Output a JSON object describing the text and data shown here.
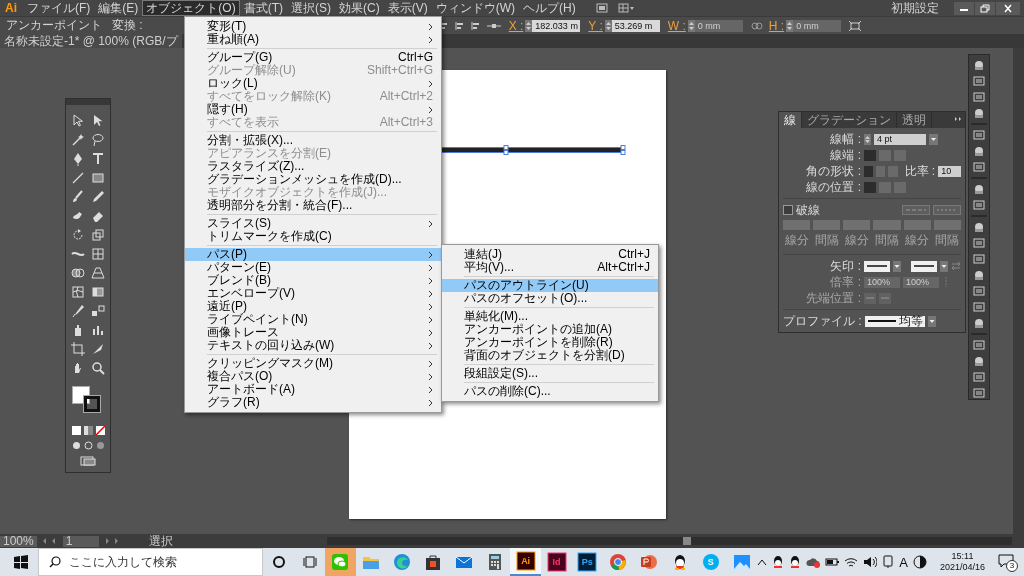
{
  "menu_bar": {
    "logo": "Ai",
    "items": [
      {
        "label": "ファイル(F)",
        "selected": false
      },
      {
        "label": "編集(E)",
        "selected": false
      },
      {
        "label": "オブジェクト(O)",
        "selected": true
      },
      {
        "label": "書式(T)",
        "selected": false
      },
      {
        "label": "選択(S)",
        "selected": false
      },
      {
        "label": "効果(C)",
        "selected": false
      },
      {
        "label": "表示(V)",
        "selected": false
      },
      {
        "label": "ウィンドウ(W)",
        "selected": false
      },
      {
        "label": "ヘルプ(H)",
        "selected": false
      }
    ],
    "workspace": "初期設定"
  },
  "control_bar": {
    "mode": "アンカーポイント",
    "convert_label": "変換 :",
    "fields": [
      {
        "label": "X :",
        "value": "182.033 m",
        "disabled": false
      },
      {
        "label": "Y :",
        "value": "53.269 m",
        "disabled": false
      },
      {
        "label": "W :",
        "value": "0 mm",
        "disabled": true
      },
      {
        "label": "H :",
        "value": "0 mm",
        "disabled": true
      }
    ]
  },
  "document_tab": "名称未設定-1* @ 100% (RGB/プ",
  "object_menu": {
    "items": [
      {
        "kind": "item",
        "label": "変形(T)",
        "submenu": true,
        "disabled": false,
        "selected": false
      },
      {
        "kind": "item",
        "label": "重ね順(A)",
        "submenu": true,
        "disabled": false,
        "selected": false
      },
      {
        "kind": "separator"
      },
      {
        "kind": "item",
        "label": "グループ(G)",
        "shortcut": "Ctrl+G",
        "submenu": false,
        "disabled": false,
        "selected": false
      },
      {
        "kind": "item",
        "label": "グループ解除(U)",
        "shortcut": "Shift+Ctrl+G",
        "submenu": false,
        "disabled": true,
        "selected": false
      },
      {
        "kind": "item",
        "label": "ロック(L)",
        "submenu": true,
        "disabled": false,
        "selected": false
      },
      {
        "kind": "item",
        "label": "すべてをロック解除(K)",
        "shortcut": "Alt+Ctrl+2",
        "submenu": false,
        "disabled": true,
        "selected": false
      },
      {
        "kind": "item",
        "label": "隠す(H)",
        "submenu": true,
        "disabled": false,
        "selected": false
      },
      {
        "kind": "item",
        "label": "すべてを表示",
        "shortcut": "Alt+Ctrl+3",
        "submenu": false,
        "disabled": true,
        "selected": false
      },
      {
        "kind": "separator"
      },
      {
        "kind": "item",
        "label": "分割・拡張(X)...",
        "submenu": false,
        "disabled": false,
        "selected": false
      },
      {
        "kind": "item",
        "label": "アピアランスを分割(E)",
        "submenu": false,
        "disabled": true,
        "selected": false
      },
      {
        "kind": "item",
        "label": "ラスタライズ(Z)...",
        "submenu": false,
        "disabled": false,
        "selected": false
      },
      {
        "kind": "item",
        "label": "グラデーションメッシュを作成(D)...",
        "submenu": false,
        "disabled": false,
        "selected": false
      },
      {
        "kind": "item",
        "label": "モザイクオブジェクトを作成(J)...",
        "submenu": false,
        "disabled": true,
        "selected": false
      },
      {
        "kind": "item",
        "label": "透明部分を分割・統合(F)...",
        "submenu": false,
        "disabled": false,
        "selected": false
      },
      {
        "kind": "separator"
      },
      {
        "kind": "item",
        "label": "スライス(S)",
        "submenu": true,
        "disabled": false,
        "selected": false
      },
      {
        "kind": "item",
        "label": "トリムマークを作成(C)",
        "submenu": false,
        "disabled": false,
        "selected": false
      },
      {
        "kind": "separator"
      },
      {
        "kind": "item",
        "label": "パス(P)",
        "submenu": true,
        "disabled": false,
        "selected": true
      },
      {
        "kind": "item",
        "label": "パターン(E)",
        "submenu": true,
        "disabled": false,
        "selected": false
      },
      {
        "kind": "item",
        "label": "ブレンド(B)",
        "submenu": true,
        "disabled": false,
        "selected": false
      },
      {
        "kind": "item",
        "label": "エンベロープ(V)",
        "submenu": true,
        "disabled": false,
        "selected": false
      },
      {
        "kind": "item",
        "label": "遠近(P)",
        "submenu": true,
        "disabled": false,
        "selected": false
      },
      {
        "kind": "item",
        "label": "ライブペイント(N)",
        "submenu": true,
        "disabled": false,
        "selected": false
      },
      {
        "kind": "item",
        "label": "画像トレース",
        "submenu": true,
        "disabled": false,
        "selected": false
      },
      {
        "kind": "item",
        "label": "テキストの回り込み(W)",
        "submenu": true,
        "disabled": false,
        "selected": false
      },
      {
        "kind": "separator"
      },
      {
        "kind": "item",
        "label": "クリッピングマスク(M)",
        "submenu": true,
        "disabled": false,
        "selected": false
      },
      {
        "kind": "item",
        "label": "複合パス(O)",
        "submenu": true,
        "disabled": false,
        "selected": false
      },
      {
        "kind": "item",
        "label": "アートボード(A)",
        "submenu": true,
        "disabled": false,
        "selected": false
      },
      {
        "kind": "item",
        "label": "グラフ(R)",
        "submenu": true,
        "disabled": false,
        "selected": false
      }
    ]
  },
  "path_submenu": {
    "items": [
      {
        "kind": "item",
        "label": "連結(J)",
        "shortcut": "Ctrl+J",
        "submenu": false,
        "disabled": false,
        "selected": false
      },
      {
        "kind": "item",
        "label": "平均(V)...",
        "shortcut": "Alt+Ctrl+J",
        "submenu": false,
        "disabled": false,
        "selected": false
      },
      {
        "kind": "separator"
      },
      {
        "kind": "item",
        "label": "パスのアウトライン(U)",
        "submenu": false,
        "disabled": false,
        "selected": true
      },
      {
        "kind": "item",
        "label": "パスのオフセット(O)...",
        "submenu": false,
        "disabled": false,
        "selected": false
      },
      {
        "kind": "separator"
      },
      {
        "kind": "item",
        "label": "単純化(M)...",
        "submenu": false,
        "disabled": false,
        "selected": false
      },
      {
        "kind": "item",
        "label": "アンカーポイントの追加(A)",
        "submenu": false,
        "disabled": false,
        "selected": false
      },
      {
        "kind": "item",
        "label": "アンカーポイントを削除(R)",
        "submenu": false,
        "disabled": false,
        "selected": false
      },
      {
        "kind": "item",
        "label": "背面のオブジェクトを分割(D)",
        "submenu": false,
        "disabled": false,
        "selected": false
      },
      {
        "kind": "separator"
      },
      {
        "kind": "item",
        "label": "段組設定(S)...",
        "submenu": false,
        "disabled": false,
        "selected": false
      },
      {
        "kind": "separator"
      },
      {
        "kind": "item",
        "label": "パスの削除(C)...",
        "submenu": false,
        "disabled": false,
        "selected": false
      }
    ]
  },
  "stroke_panel": {
    "tabs": [
      {
        "label": "線",
        "selected": true
      },
      {
        "label": "グラデーション",
        "selected": false
      },
      {
        "label": "透明",
        "selected": false
      }
    ],
    "weight": {
      "label": "線幅 :",
      "value": "4 pt"
    },
    "cap": {
      "label": "線端 :",
      "options": [
        {
          "selected": true
        },
        {
          "selected": false
        },
        {
          "selected": false
        }
      ]
    },
    "corner": {
      "label": "角の形状 :",
      "options": [
        {
          "selected": true
        },
        {
          "selected": false
        },
        {
          "selected": false
        }
      ],
      "limit_label": "比率 :",
      "limit": "10"
    },
    "align": {
      "label": "線の位置 :",
      "options": [
        {
          "selected": true
        },
        {
          "selected": false
        },
        {
          "selected": false
        }
      ]
    },
    "dashed": {
      "label": "破線",
      "checked": false
    },
    "dash_fields": [
      "線分",
      "間隔",
      "線分",
      "間隔",
      "線分",
      "間隔"
    ],
    "arrow": {
      "label": "矢印 :"
    },
    "scale": {
      "label": "倍率 :",
      "values": [
        "100%",
        "100%"
      ],
      "disabled": true
    },
    "tip": {
      "label": "先端位置 :",
      "disabled": true
    },
    "profile": {
      "label": "プロファイル :",
      "value": "均等"
    }
  },
  "status_bar": {
    "zoom": "100%",
    "artboard": "1",
    "tool": "選択"
  },
  "taskbar": {
    "search_placeholder": "ここに入力して検索",
    "apps": [
      {
        "kind": "wechat",
        "active": false,
        "attention": true
      },
      {
        "kind": "explorer",
        "active": false,
        "attention": false
      },
      {
        "kind": "edge",
        "active": false,
        "attention": false
      },
      {
        "kind": "store",
        "active": false,
        "attention": false
      },
      {
        "kind": "mail",
        "active": false,
        "attention": false
      },
      {
        "kind": "calculator",
        "active": false,
        "attention": false
      },
      {
        "kind": "illustrator",
        "label": "Ai",
        "active": true,
        "attention": false
      },
      {
        "kind": "indesign",
        "label": "Id",
        "active": false,
        "attention": false
      },
      {
        "kind": "photoshop",
        "label": "Ps",
        "active": false,
        "attention": false
      },
      {
        "kind": "chrome",
        "active": false,
        "attention": false
      },
      {
        "kind": "powerpoint",
        "active": false,
        "attention": false
      },
      {
        "kind": "qq",
        "active": false,
        "attention": false
      },
      {
        "kind": "skype",
        "label": "S",
        "active": false,
        "attention": false
      },
      {
        "kind": "photos",
        "active": false,
        "attention": false
      }
    ],
    "ime": "A",
    "time": "15:11",
    "date": "2021/04/16",
    "notifications": "3"
  }
}
